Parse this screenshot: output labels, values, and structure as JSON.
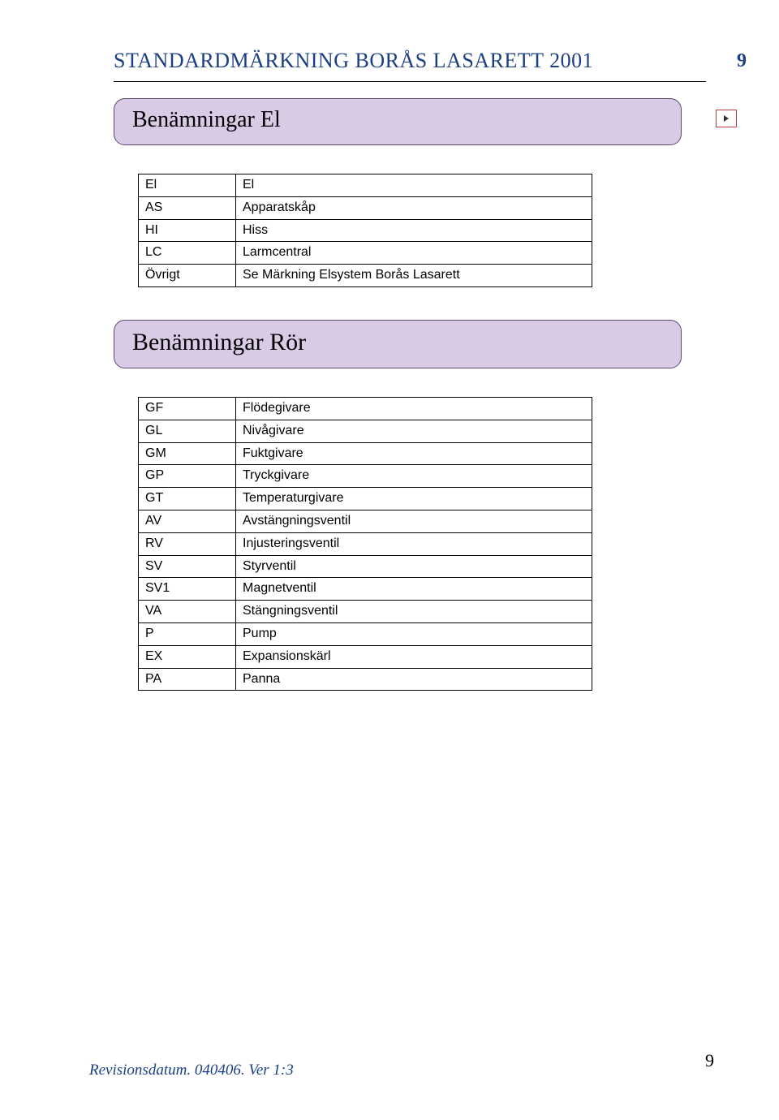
{
  "header": {
    "title": "STANDARDMÄRKNING BORÅS LASARETT 2001",
    "pageTop": "9"
  },
  "section1": {
    "title": "Benämningar El",
    "rows": [
      {
        "code": "El",
        "label": "El"
      },
      {
        "code": "AS",
        "label": "Apparatskåp"
      },
      {
        "code": "HI",
        "label": "Hiss"
      },
      {
        "code": "LC",
        "label": "Larmcentral"
      },
      {
        "code": "Övrigt",
        "label": "Se Märkning Elsystem Borås Lasarett"
      }
    ]
  },
  "section2": {
    "title": "Benämningar Rör",
    "rows": [
      {
        "code": "GF",
        "label": "Flödegivare"
      },
      {
        "code": "GL",
        "label": "Nivågivare"
      },
      {
        "code": "GM",
        "label": "Fuktgivare"
      },
      {
        "code": "GP",
        "label": "Tryckgivare"
      },
      {
        "code": "GT",
        "label": "Temperaturgivare"
      },
      {
        "code": "AV",
        "label": "Avstängningsventil"
      },
      {
        "code": "RV",
        "label": "Injusteringsventil"
      },
      {
        "code": "SV",
        "label": "Styrventil"
      },
      {
        "code": "SV1",
        "label": "Magnetventil"
      },
      {
        "code": "VA",
        "label": "Stängningsventil"
      },
      {
        "code": "P",
        "label": "Pump"
      },
      {
        "code": "EX",
        "label": "Expansionskärl"
      },
      {
        "code": "PA",
        "label": "Panna"
      }
    ]
  },
  "footer": {
    "left": "Revisionsdatum. 040406. Ver 1:3",
    "right": "9"
  }
}
